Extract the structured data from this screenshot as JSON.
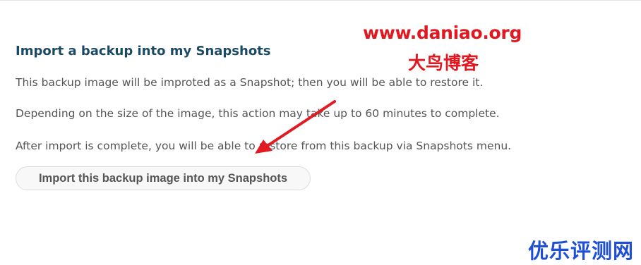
{
  "import_section": {
    "title": "Import a backup into my Snapshots",
    "paragraphs": [
      "This backup image will be improted as a Snapshot; then you will be able to restore it.",
      "Depending on the size of the image, this action may take up to 60 minutes to complete.",
      "After import is complete, you will be able to restore from this backup via Snapshots menu."
    ],
    "button_label": "Import this backup image into my Snapshots"
  },
  "watermarks": {
    "site_url": "www.daniao.org",
    "site_name": "大鸟博客",
    "corner_brand": "优乐评测网"
  },
  "colors": {
    "title": "#1d4a63",
    "body_text": "#555555",
    "watermark_red": "#e1181f",
    "watermark_blue": "#1e4fd6",
    "annotation_arrow": "#e01b22"
  }
}
